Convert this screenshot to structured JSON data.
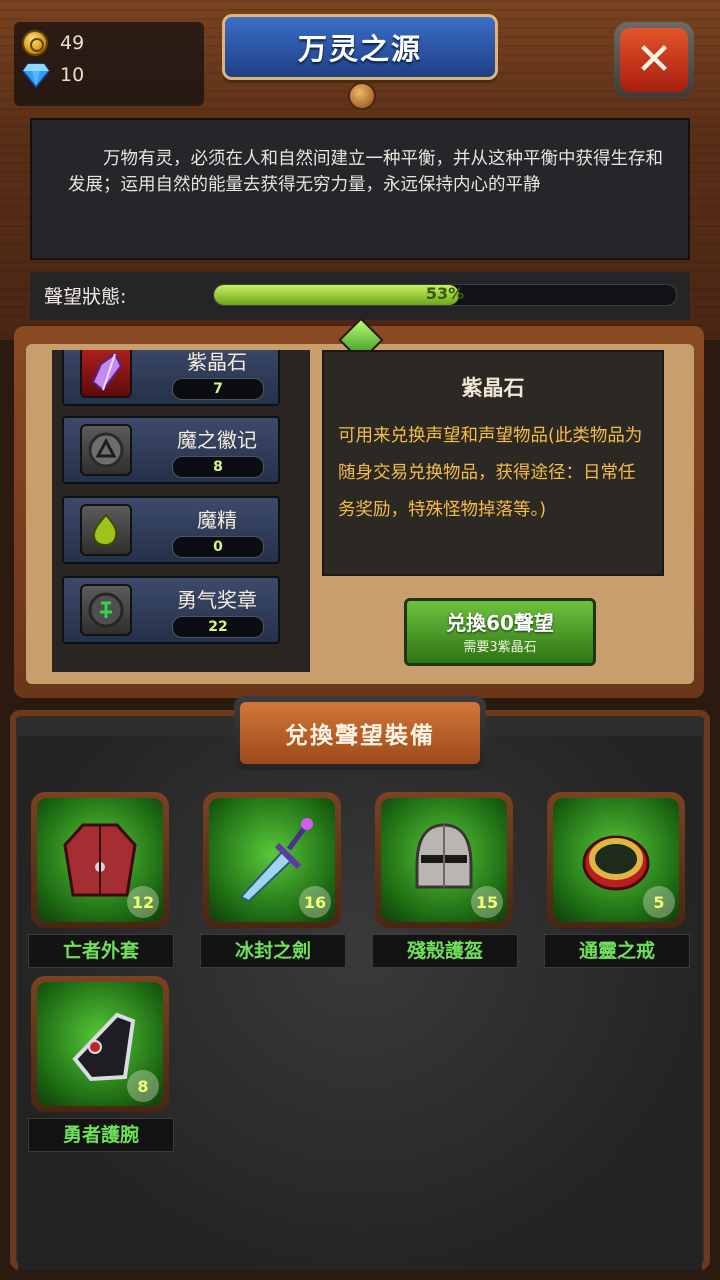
{
  "currency": {
    "gold": "49",
    "gems": "10"
  },
  "window": {
    "title": "万灵之源"
  },
  "faction": {
    "description": "万物有灵，必须在人和自然间建立一种平衡，并从这种平衡中获得生存和发展；运用自然的能量去获得无穷力量，永远保持内心的平静",
    "reputation_label": "聲望狀態:",
    "reputation_percent": "53%",
    "reputation_fraction": 0.53
  },
  "items": [
    {
      "name": "紫晶石",
      "count": "7"
    },
    {
      "name": "魔之徽记",
      "count": "8"
    },
    {
      "name": "魔精",
      "count": "0"
    },
    {
      "name": "勇气奖章",
      "count": "22"
    }
  ],
  "detail": {
    "title": "紫晶石",
    "description": "可用来兑换声望和声望物品(此类物品为随身交易兑换物品，获得途径：日常任务奖励，特殊怪物掉落等。)",
    "button_label": "兑換60聲望",
    "button_sub": "需要3紫晶石"
  },
  "section": {
    "title": "兌換聲望裝備"
  },
  "equipment": [
    {
      "name": "亡者外套",
      "level": "12"
    },
    {
      "name": "冰封之劍",
      "level": "16"
    },
    {
      "name": "殘殼護盔",
      "level": "15"
    },
    {
      "name": "通靈之戒",
      "level": "5"
    },
    {
      "name": "勇者護腕",
      "level": "8"
    }
  ],
  "icons": {
    "gold": "gold-coin-icon",
    "gem": "diamond-icon",
    "close": "close-icon",
    "items": [
      "purple-crystal-icon",
      "demon-emblem-icon",
      "demon-essence-icon",
      "courage-medal-icon"
    ],
    "equipment": [
      "coat-icon",
      "sword-icon",
      "helmet-icon",
      "ring-icon",
      "bracer-icon"
    ]
  },
  "colors": {
    "accent_green": "#6fe05a",
    "progress": "#9ed43a",
    "detail_text": "#f3bd48"
  }
}
